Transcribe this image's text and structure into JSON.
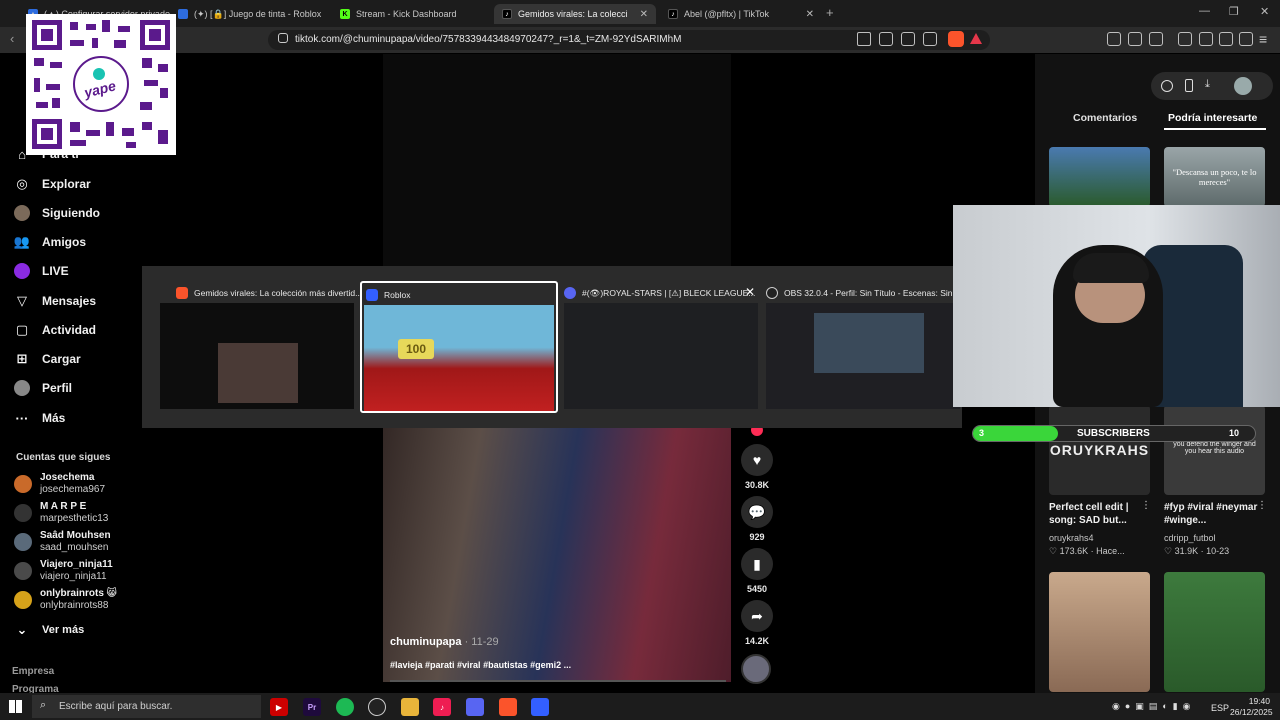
{
  "browser": {
    "tabs": [
      {
        "label": "(▲) Configurar servidor privado - R",
        "active": false
      },
      {
        "label": "(✦) [🔒] Juego de tinta - Roblox",
        "active": false
      },
      {
        "label": "Stream - Kick Dashboard",
        "active": false
      },
      {
        "label": "Gemidos virales: La colecci",
        "active": true
      },
      {
        "label": "Abel (@pfltx) | TikTok",
        "active": false
      }
    ],
    "url": "tiktok.com/@chuminupapa/video/7578339443484970247?_r=1&_t=ZM-92YdSARIMhM"
  },
  "overlay": {
    "qr_label": "yape"
  },
  "sidebar": {
    "nav": [
      {
        "label": "Para ti",
        "icon": "home-icon"
      },
      {
        "label": "Explorar",
        "icon": "compass-icon"
      },
      {
        "label": "Siguiendo",
        "icon": "following-icon"
      },
      {
        "label": "Amigos",
        "icon": "friends-icon"
      },
      {
        "label": "LIVE",
        "icon": "live-icon"
      },
      {
        "label": "Mensajes",
        "icon": "messages-icon"
      },
      {
        "label": "Actividad",
        "icon": "activity-icon"
      },
      {
        "label": "Cargar",
        "icon": "upload-icon"
      },
      {
        "label": "Perfil",
        "icon": "profile-icon"
      },
      {
        "label": "Más",
        "icon": "more-icon"
      }
    ],
    "following_title": "Cuentas que sigues",
    "following": [
      {
        "name": "Josechema",
        "handle": "josechema967"
      },
      {
        "name": "M A R P E",
        "handle": "marpesthetic13"
      },
      {
        "name": "Saâd Mouhsen",
        "handle": "saad_mouhsen"
      },
      {
        "name": "Viajero_ninja11",
        "handle": "viajero_ninja11"
      },
      {
        "name": "onlybrainrots 😸",
        "handle": "onlybrainrots88"
      }
    ],
    "see_more": "Ver más",
    "footer": [
      "Empresa",
      "Programa"
    ]
  },
  "video": {
    "author": "chuminupapa",
    "date": "11-29",
    "separator": " · ",
    "tags": "#lavieja #parati #viral #bautistas #gemi2 ...",
    "actions": [
      {
        "icon": "heart-icon",
        "count": "30.8K"
      },
      {
        "icon": "comment-icon",
        "count": "929"
      },
      {
        "icon": "bookmark-icon",
        "count": "5450"
      },
      {
        "icon": "share-icon",
        "count": "14.2K"
      }
    ]
  },
  "right_panel": {
    "tabs": [
      "Comentarios",
      "Podría interesarte"
    ],
    "quote": "\"Descansa un poco, te lo mereces\"",
    "cards": [
      {
        "caption": "Perfect cell edit | song: SAD but...",
        "user": "oruykrahs4",
        "likes": "173.6K",
        "date": "Hace...",
        "thumb_text": "ORUYKRAHS"
      },
      {
        "caption": "#fyp #viral #neymar #winge...",
        "user": "cdripp_futbol",
        "likes": "31.9K",
        "date": "10-23",
        "thumb_text": "you defend the winger and you hear this audio"
      }
    ]
  },
  "task_switcher": {
    "windows": [
      {
        "title": "Gemidos virales: La colección más divertid...",
        "icon": "brave-icon"
      },
      {
        "title": "Roblox",
        "icon": "roblox-icon"
      },
      {
        "title": "#(👁)ROYAL-STARS | [⚠] BLECK LEAGUE...",
        "icon": "discord-icon"
      },
      {
        "title": "OBS 32.0.4 - Perfil: Sin Título - Escenas: Sin...",
        "icon": "obs-icon"
      }
    ],
    "roblox_sign": "100"
  },
  "sub_goal": {
    "current": "3",
    "target": "10",
    "label": "SUBSCRIBERS",
    "progress": 0.3
  },
  "taskbar": {
    "search_placeholder": "Escribe aquí para buscar.",
    "lang": "ESP",
    "time": "19:40",
    "date": "26/12/2025"
  },
  "colors": {
    "accent": "#fe2c55",
    "goal_green": "#3ad63a"
  }
}
